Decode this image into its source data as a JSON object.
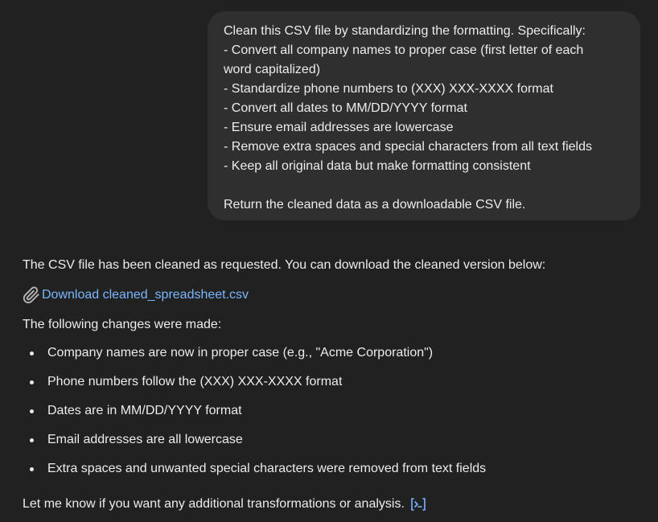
{
  "user_message": {
    "lines": [
      "Clean this CSV file by standardizing the formatting. Specifically:",
      "- Convert all company names to proper case (first letter of each",
      "word capitalized)",
      "- Standardize phone numbers to (XXX) XXX-XXXX format",
      "- Convert all dates to MM/DD/YYYY format",
      "- Ensure email addresses are lowercase",
      "- Remove extra spaces and special characters from all text fields",
      "- Keep all original data but make formatting consistent",
      "",
      "Return the cleaned data as a downloadable CSV file."
    ]
  },
  "assistant_message": {
    "intro": "The CSV file has been cleaned as requested. You can download the cleaned version below:",
    "download_icon": "paperclip-icon",
    "download_label": "Download cleaned_spreadsheet.csv",
    "changes_heading": "The following changes were made:",
    "changes": [
      "Company names are now in proper case (e.g., \"Acme Corporation\")",
      "Phone numbers follow the (XXX) XXX-XXXX format",
      "Dates are in MM/DD/YYYY format",
      "Email addresses are all lowercase",
      "Extra spaces and unwanted special characters were removed from text fields"
    ],
    "outro": "Let me know if you want any additional transformations or analysis.",
    "code_icon": "code-interpreter-icon"
  },
  "colors": {
    "background": "#212121",
    "user_bubble": "#2f2f2f",
    "text": "#ececec",
    "link": "#7ab7ff"
  }
}
